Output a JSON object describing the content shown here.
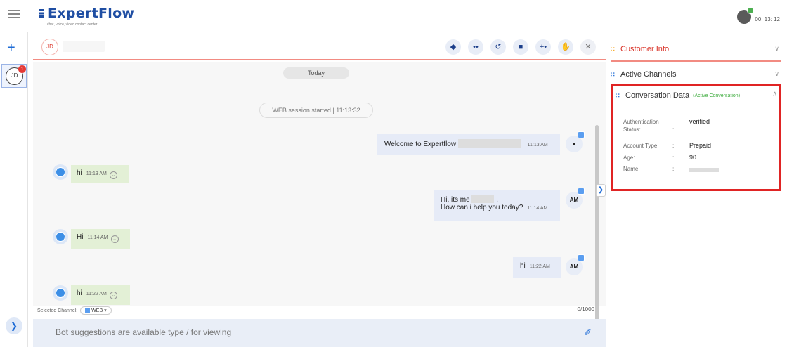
{
  "app": {
    "logo_text": "ExpertFlow",
    "logo_tagline": "chat, voice, video contact center"
  },
  "agent": {
    "timer": "00: 13: 12"
  },
  "conversation_list": {
    "item_initials": "JD",
    "unread_count": "1"
  },
  "chat": {
    "customer_initials": "JD",
    "actions": [
      "bot-icon",
      "participants-icon",
      "history-icon",
      "wrapup-icon",
      "add-agent-icon",
      "hand-icon",
      "close-icon"
    ],
    "date_separator": "Today",
    "session_label": "WEB session started | 11:13:32",
    "messages": [
      {
        "from": "bot",
        "text": "Welcome to Expertflow",
        "time": "11:13 AM"
      },
      {
        "from": "customer",
        "text": "hi",
        "time": "11:13 AM"
      },
      {
        "from": "agent",
        "line1": "Hi, its me",
        "line2": "How can i help you today?",
        "time": "11:14 AM",
        "initials": "AM"
      },
      {
        "from": "customer",
        "text": "Hi",
        "time": "11:14 AM"
      },
      {
        "from": "agent",
        "text": "hi",
        "time": "11:22 AM",
        "initials": "AM"
      },
      {
        "from": "customer",
        "text": "hi",
        "time": "11:22 AM"
      }
    ],
    "selected_channel_label": "Selected Channel:",
    "selected_channel_value": "WEB",
    "char_counter": "0/1000",
    "composer_placeholder": "Bot suggestions are available type / for viewing"
  },
  "right_panel": {
    "customer_info_title": "Customer Info",
    "active_channels_title": "Active Channels",
    "conversation_data_title": "Conversation Data",
    "conversation_data_tag": "(Active Conversation)",
    "fields": [
      {
        "key_line1": "Authentication",
        "key_line2": "Status:",
        "value": "verified"
      },
      {
        "key": "Account Type:",
        "value": "Prepaid"
      },
      {
        "key": "Age:",
        "value": "90"
      },
      {
        "key": "Name:",
        "value": ""
      }
    ]
  },
  "colors": {
    "brand": "#1f4ea3",
    "accent": "#1f6cd6",
    "alert": "#d93025",
    "highlight_border": "#e02424"
  }
}
